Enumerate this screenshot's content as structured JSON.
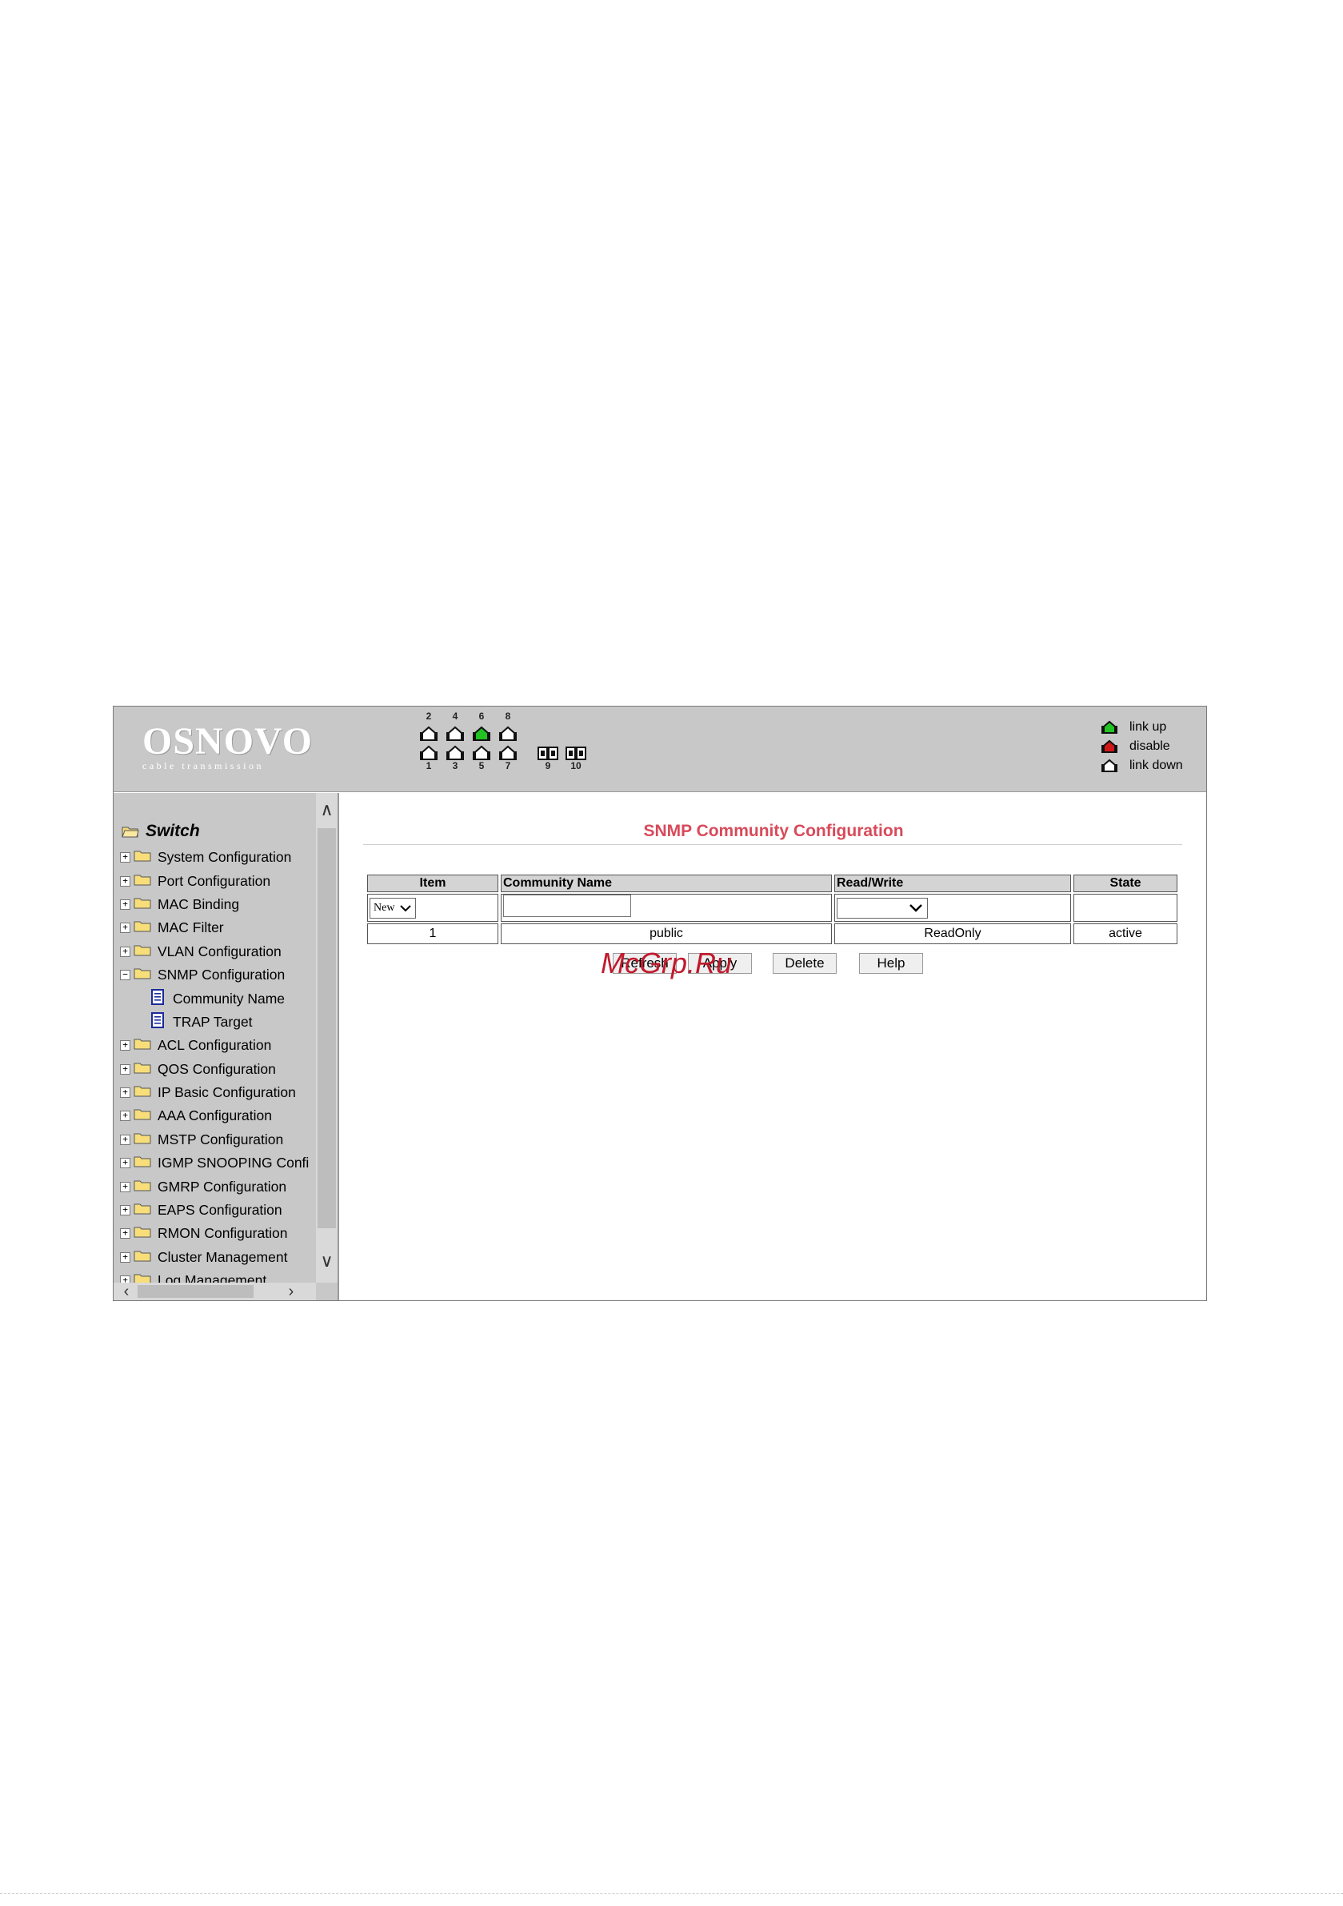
{
  "header": {
    "logo_title": "OSNOVO",
    "logo_subtitle": "cable transmission",
    "ports_top": [
      {
        "num": "2",
        "state": "link down"
      },
      {
        "num": "4",
        "state": "link down"
      },
      {
        "num": "6",
        "state": "link up"
      },
      {
        "num": "8",
        "state": "link down"
      }
    ],
    "ports_bottom": [
      {
        "num": "1",
        "state": "link down"
      },
      {
        "num": "3",
        "state": "link down"
      },
      {
        "num": "5",
        "state": "link down"
      },
      {
        "num": "7",
        "state": "link down"
      }
    ],
    "fiber_ports": [
      "9",
      "10"
    ],
    "legend": [
      {
        "label": "link up",
        "color": "#22c322"
      },
      {
        "label": "disable",
        "color": "#d01818"
      },
      {
        "label": "link down",
        "color": "#ffffff"
      }
    ]
  },
  "sidebar": {
    "root_label": "Switch",
    "items": [
      {
        "label": "System Configuration",
        "expanded": false
      },
      {
        "label": "Port Configuration",
        "expanded": false
      },
      {
        "label": "MAC Binding",
        "expanded": false
      },
      {
        "label": "MAC Filter",
        "expanded": false
      },
      {
        "label": "VLAN Configuration",
        "expanded": false
      },
      {
        "label": "SNMP Configuration",
        "expanded": true
      },
      {
        "label": "Community Name",
        "child": true
      },
      {
        "label": "TRAP Target",
        "child": true
      },
      {
        "label": "ACL Configuration",
        "expanded": false
      },
      {
        "label": "QOS Configuration",
        "expanded": false
      },
      {
        "label": "IP Basic Configuration",
        "expanded": false
      },
      {
        "label": "AAA Configuration",
        "expanded": false
      },
      {
        "label": "MSTP Configuration",
        "expanded": false
      },
      {
        "label": "IGMP SNOOPING Confi",
        "expanded": false
      },
      {
        "label": "GMRP Configuration",
        "expanded": false
      },
      {
        "label": "EAPS Configuration",
        "expanded": false
      },
      {
        "label": "RMON Configuration",
        "expanded": false
      },
      {
        "label": "Cluster Management",
        "expanded": false
      },
      {
        "label": "Log Management",
        "expanded": false
      }
    ]
  },
  "main": {
    "title": "SNMP Community Configuration",
    "table": {
      "headers": [
        "Item",
        "Community Name",
        "Read/Write",
        "State"
      ],
      "new_row": {
        "item_select": "New",
        "community_name": "",
        "read_write": "",
        "state": ""
      },
      "rows": [
        {
          "item": "1",
          "community_name": "public",
          "read_write": "ReadOnly",
          "state": "active"
        }
      ]
    },
    "buttons": {
      "refresh": "Refresh",
      "apply": "Apply",
      "delete": "Delete",
      "help": "Help"
    },
    "watermark": "McGrp.Ru"
  },
  "colors": {
    "title_red": "#d84a5a",
    "header_gray": "#c8c8c8",
    "link_up_green": "#22c322",
    "disable_red": "#d01818"
  }
}
